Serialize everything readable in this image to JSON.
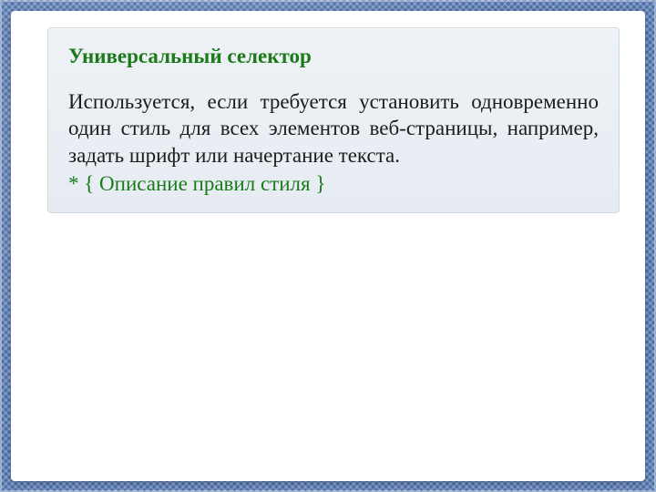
{
  "slide": {
    "title": "Универсальный селектор",
    "body": "Используется, если требуется установить одновременно один стиль для всех элементов веб-страницы, например, задать шрифт или начертание текста.",
    "code": "* { Описание правил стиля }"
  }
}
